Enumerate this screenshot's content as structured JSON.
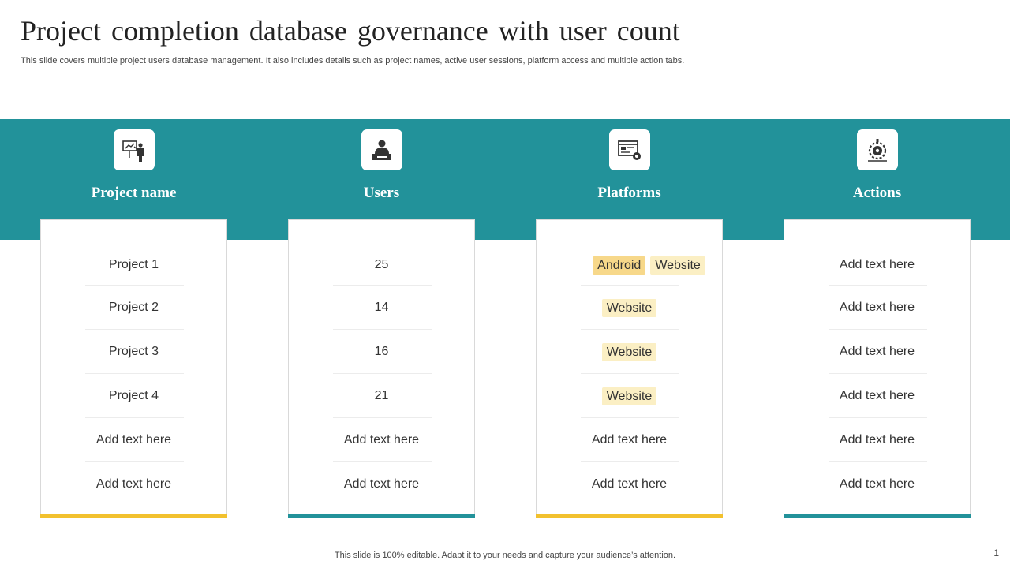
{
  "slide": {
    "title": "Project completion database governance with user count",
    "subtitle": "This slide covers multiple project users database management. It also includes details such as project names, active user sessions, platform access and multiple action tabs.",
    "footer": "This slide is 100% editable. Adapt it to your needs and capture your audience’s attention.",
    "page_number": "1"
  },
  "colors": {
    "band": "#22929a",
    "accent_yellow": "#f2c12e",
    "accent_teal": "#22929a",
    "tag_strong": "#f7d88a",
    "tag_light": "#fbefc4"
  },
  "columns": [
    {
      "title": "Project name",
      "icon": "presentation-icon",
      "rows": [
        "Project 1",
        "Project 2",
        "Project 3",
        "Project 4",
        "Add text here",
        "Add text here"
      ]
    },
    {
      "title": "Users",
      "icon": "user-icon",
      "rows": [
        "25",
        "14",
        "16",
        "21",
        "Add text here",
        "Add text here"
      ]
    },
    {
      "title": "Platforms",
      "icon": "browser-settings-icon",
      "rows": [
        {
          "tags": [
            "Android",
            "Website"
          ]
        },
        {
          "tags": [
            "Website"
          ]
        },
        {
          "tags": [
            "Website"
          ]
        },
        {
          "tags": [
            "Website"
          ]
        },
        "Add text here",
        "Add text here"
      ]
    },
    {
      "title": "Actions",
      "icon": "gear-target-icon",
      "rows": [
        "Add text here",
        "Add text here",
        "Add text here",
        "Add text here",
        "Add text here",
        "Add text here"
      ]
    }
  ]
}
